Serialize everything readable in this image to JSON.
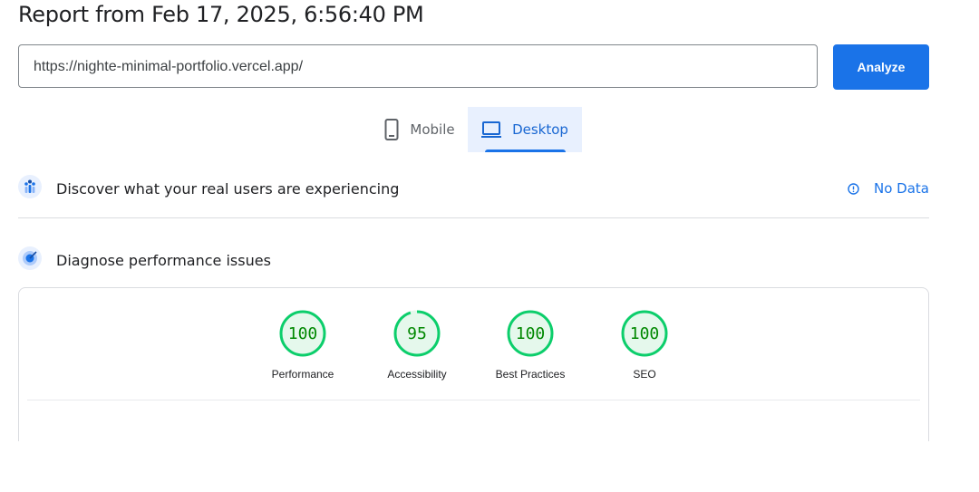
{
  "report": {
    "title": "Report from Feb 17, 2025, 6:56:40 PM"
  },
  "url_input": {
    "value": "https://nighte-minimal-portfolio.vercel.app/"
  },
  "analyze_button": {
    "label": "Analyze"
  },
  "device_tabs": [
    {
      "label": "Mobile",
      "icon": "smartphone-icon",
      "selected": false
    },
    {
      "label": "Desktop",
      "icon": "laptop-icon",
      "selected": true
    }
  ],
  "crux_section": {
    "label": "Discover what your real users are experiencing",
    "status": "No Data",
    "status_icon": "info-icon"
  },
  "diagnose_section": {
    "label": "Diagnose performance issues"
  },
  "scores": [
    {
      "value": 100,
      "label": "Performance"
    },
    {
      "value": 95,
      "label": "Accessibility"
    },
    {
      "value": 100,
      "label": "Best Practices"
    },
    {
      "value": 100,
      "label": "SEO"
    }
  ],
  "colors": {
    "accent": "#1a73e8",
    "pass": "#0cce6b",
    "pass_text": "#008800",
    "pass_bg": "#e5f8ec"
  }
}
